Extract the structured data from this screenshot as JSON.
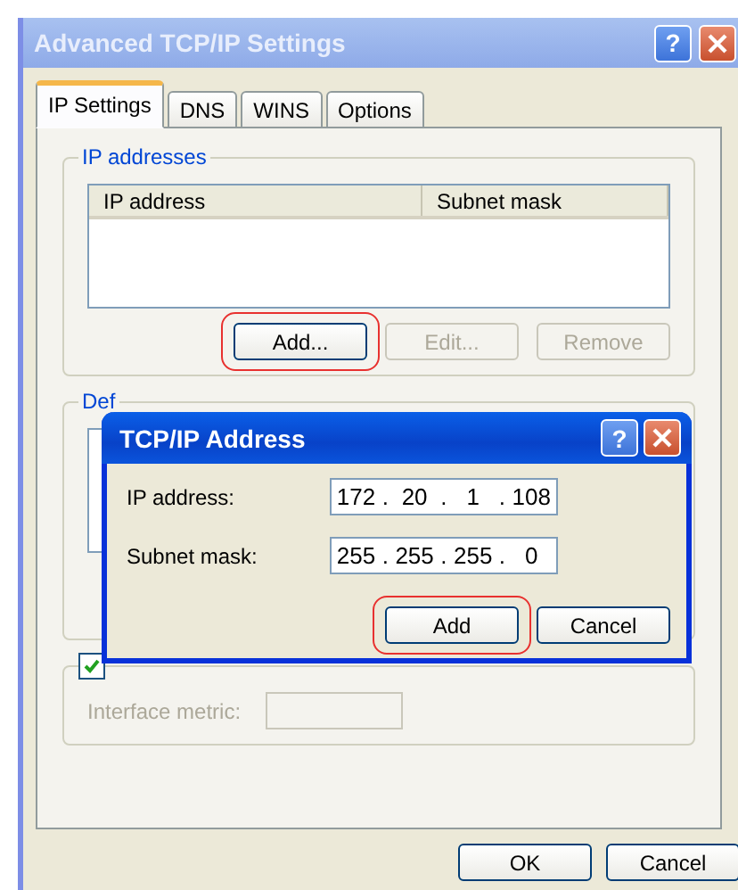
{
  "window": {
    "title": "Advanced TCP/IP Settings",
    "help": "?"
  },
  "tabs": [
    {
      "label": "IP Settings",
      "selected": true
    },
    {
      "label": "DNS",
      "selected": false
    },
    {
      "label": "WINS",
      "selected": false
    },
    {
      "label": "Options",
      "selected": false
    }
  ],
  "ip_addresses": {
    "legend": "IP addresses",
    "columns": [
      "IP address",
      "Subnet mask"
    ],
    "buttons": [
      {
        "label": "Add...",
        "disabled": false,
        "highlighted": true
      },
      {
        "label": "Edit...",
        "disabled": true,
        "highlighted": false
      },
      {
        "label": "Remove",
        "disabled": true,
        "highlighted": false
      }
    ]
  },
  "default_gateways": {
    "legend": "Def"
  },
  "metric": {
    "automatic_checked": true,
    "interface_metric_label": "Interface metric:",
    "disabled": true
  },
  "buttons": [
    "OK",
    "Cancel"
  ],
  "dialog": {
    "title": "TCP/IP Address",
    "help": "?",
    "separator": ".",
    "fields": [
      {
        "label": "IP address:",
        "octets": [
          "172",
          "20",
          "1",
          "108"
        ]
      },
      {
        "label": "Subnet mask:",
        "octets": [
          "255",
          "255",
          "255",
          "0"
        ]
      }
    ],
    "buttons": [
      {
        "label": "Add",
        "highlighted": true
      },
      {
        "label": "Cancel",
        "highlighted": false
      }
    ]
  }
}
